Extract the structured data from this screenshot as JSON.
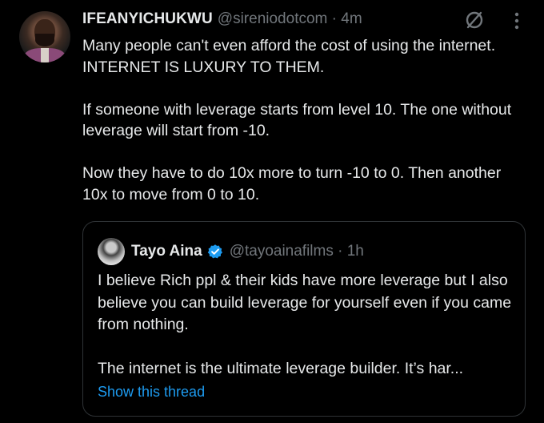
{
  "tweet": {
    "author_name": "IFEANYICHUKWU",
    "handle_time": "@sireniodotcom · 4m",
    "text": "Many people can't even afford the cost of using the internet. INTERNET IS LUXURY TO THEM.\n\nIf someone with leverage starts from level 10. The one without leverage will start from -10.\n\nNow they have to do 10x more to turn -10 to 0. Then another 10x to move from 0 to 10.",
    "icons": {
      "right_1": "no-entry-slash-icon",
      "right_2": "more-options-icon"
    }
  },
  "quoted_tweet": {
    "author_name": "Tayo Aina",
    "verified": true,
    "handle_time": "@tayoainafilms · 1h",
    "text": "I believe Rich ppl & their kids have more leverage but I also believe you can build leverage for yourself even if you came from nothing.\n\nThe internet is the ultimate leverage builder. It’s har...",
    "show_thread_label": "Show this thread"
  },
  "colors": {
    "background": "#000000",
    "text": "#e7e9ea",
    "secondary": "#71767b",
    "link": "#1d9bf0",
    "border": "#2f3336"
  }
}
